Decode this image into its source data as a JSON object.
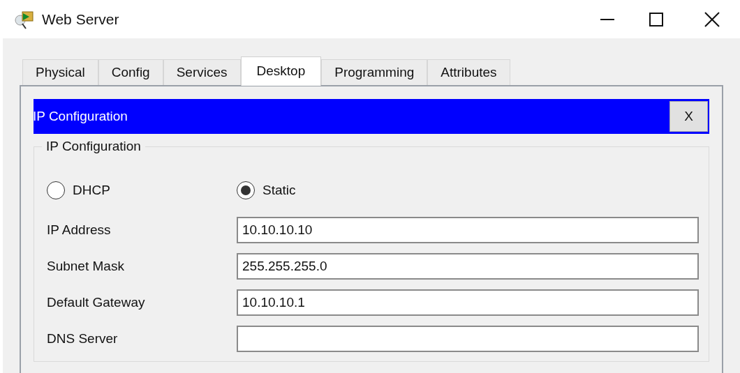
{
  "window": {
    "title": "Web Server"
  },
  "tabs": [
    {
      "label": "Physical",
      "selected": false
    },
    {
      "label": "Config",
      "selected": false
    },
    {
      "label": "Services",
      "selected": false
    },
    {
      "label": "Desktop",
      "selected": true
    },
    {
      "label": "Programming",
      "selected": false
    },
    {
      "label": "Attributes",
      "selected": false
    }
  ],
  "app_header": {
    "title": "IP Configuration",
    "close_label": "X"
  },
  "group": {
    "legend": "IP Configuration",
    "modes": [
      {
        "label": "DHCP",
        "selected": false
      },
      {
        "label": "Static",
        "selected": true
      }
    ],
    "fields": [
      {
        "label": "IP Address",
        "value": "10.10.10.10"
      },
      {
        "label": "Subnet Mask",
        "value": "255.255.255.0"
      },
      {
        "label": "Default Gateway",
        "value": "10.10.10.1"
      },
      {
        "label": "DNS Server"
      }
    ]
  }
}
